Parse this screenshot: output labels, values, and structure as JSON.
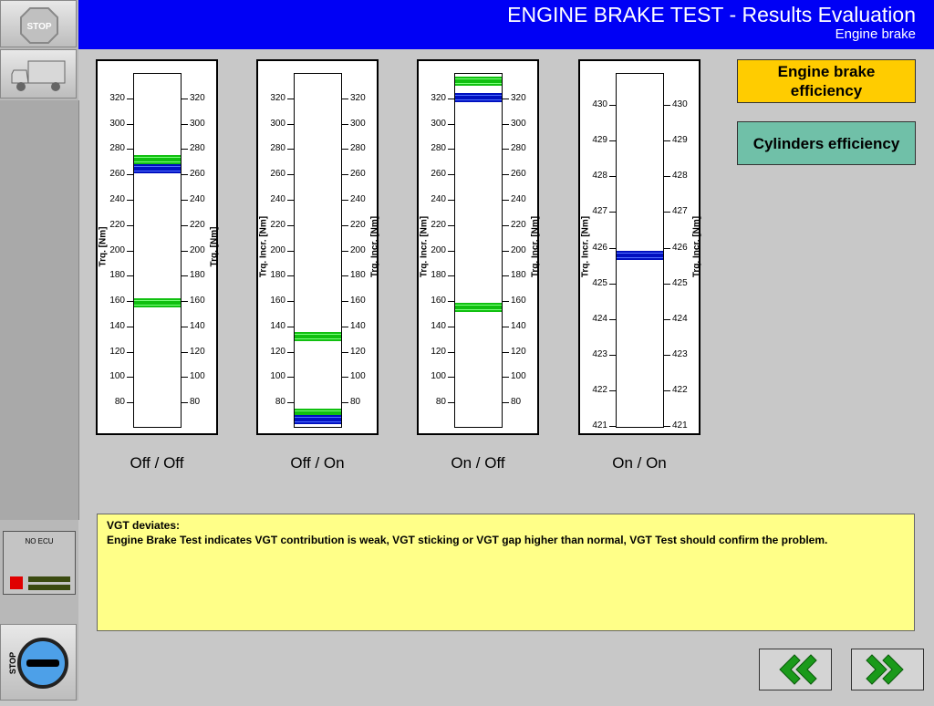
{
  "sidebar": {
    "stop_label": "STOP",
    "ecu_label": "NO ECU",
    "stop_key_label": "STOP",
    "ecu_status_color": "#e00000"
  },
  "header": {
    "title": "ENGINE BRAKE TEST - Results Evaluation",
    "subtitle": "Engine brake"
  },
  "gauges": [
    {
      "label": "Off / Off",
      "axis_left": "Trq. [Nm]",
      "axis_right": "Trq. [Nm]",
      "ticks": [
        "320",
        "300",
        "280",
        "260",
        "240",
        "220",
        "200",
        "180",
        "160",
        "140",
        "120",
        "100",
        "80"
      ],
      "range": [
        60,
        340
      ],
      "markers": [
        {
          "color": "green",
          "value": 272
        },
        {
          "color": "blue",
          "value": 265
        },
        {
          "color": "green",
          "value": 159
        }
      ]
    },
    {
      "label": "Off / On",
      "axis_left": "Trq. Incr. [Nm]",
      "axis_right": "Trq. Incr. [Nm]",
      "ticks": [
        "320",
        "300",
        "280",
        "260",
        "240",
        "220",
        "200",
        "180",
        "160",
        "140",
        "120",
        "100",
        "80"
      ],
      "range": [
        60,
        340
      ],
      "markers": [
        {
          "color": "green",
          "value": 133
        },
        {
          "color": "green",
          "value": 72
        },
        {
          "color": "blue",
          "value": 67
        }
      ]
    },
    {
      "label": "On / Off",
      "axis_left": "Trq. Incr. [Nm]",
      "axis_right": "Trq. Incr. [Nm]",
      "ticks": [
        "320",
        "300",
        "280",
        "260",
        "240",
        "220",
        "200",
        "180",
        "160",
        "140",
        "120",
        "100",
        "80"
      ],
      "range": [
        60,
        340
      ],
      "markers": [
        {
          "color": "green",
          "value": 334
        },
        {
          "color": "blue",
          "value": 321
        },
        {
          "color": "green",
          "value": 156
        }
      ]
    },
    {
      "label": "On / On",
      "axis_left": "Trq. Incr. [Nm]",
      "axis_right": "Trq. Incr. [Nm]",
      "ticks": [
        "430",
        "429",
        "428",
        "427",
        "426",
        "425",
        "424",
        "423",
        "422",
        "421"
      ],
      "range": [
        420.95,
        430.9
      ],
      "markers": [
        {
          "color": "blue",
          "value": 425.8
        }
      ]
    }
  ],
  "buttons": {
    "engine_brake_efficiency": "Engine brake efficiency",
    "cylinders_efficiency": "Cylinders efficiency"
  },
  "message": {
    "heading": "VGT deviates:",
    "text": "Engine Brake Test indicates VGT contribution is weak, VGT sticking or VGT gap higher than normal, VGT Test should confirm the problem."
  },
  "nav": {
    "back_icon": "double-chevron-left-icon",
    "forward_icon": "double-chevron-right-icon"
  }
}
